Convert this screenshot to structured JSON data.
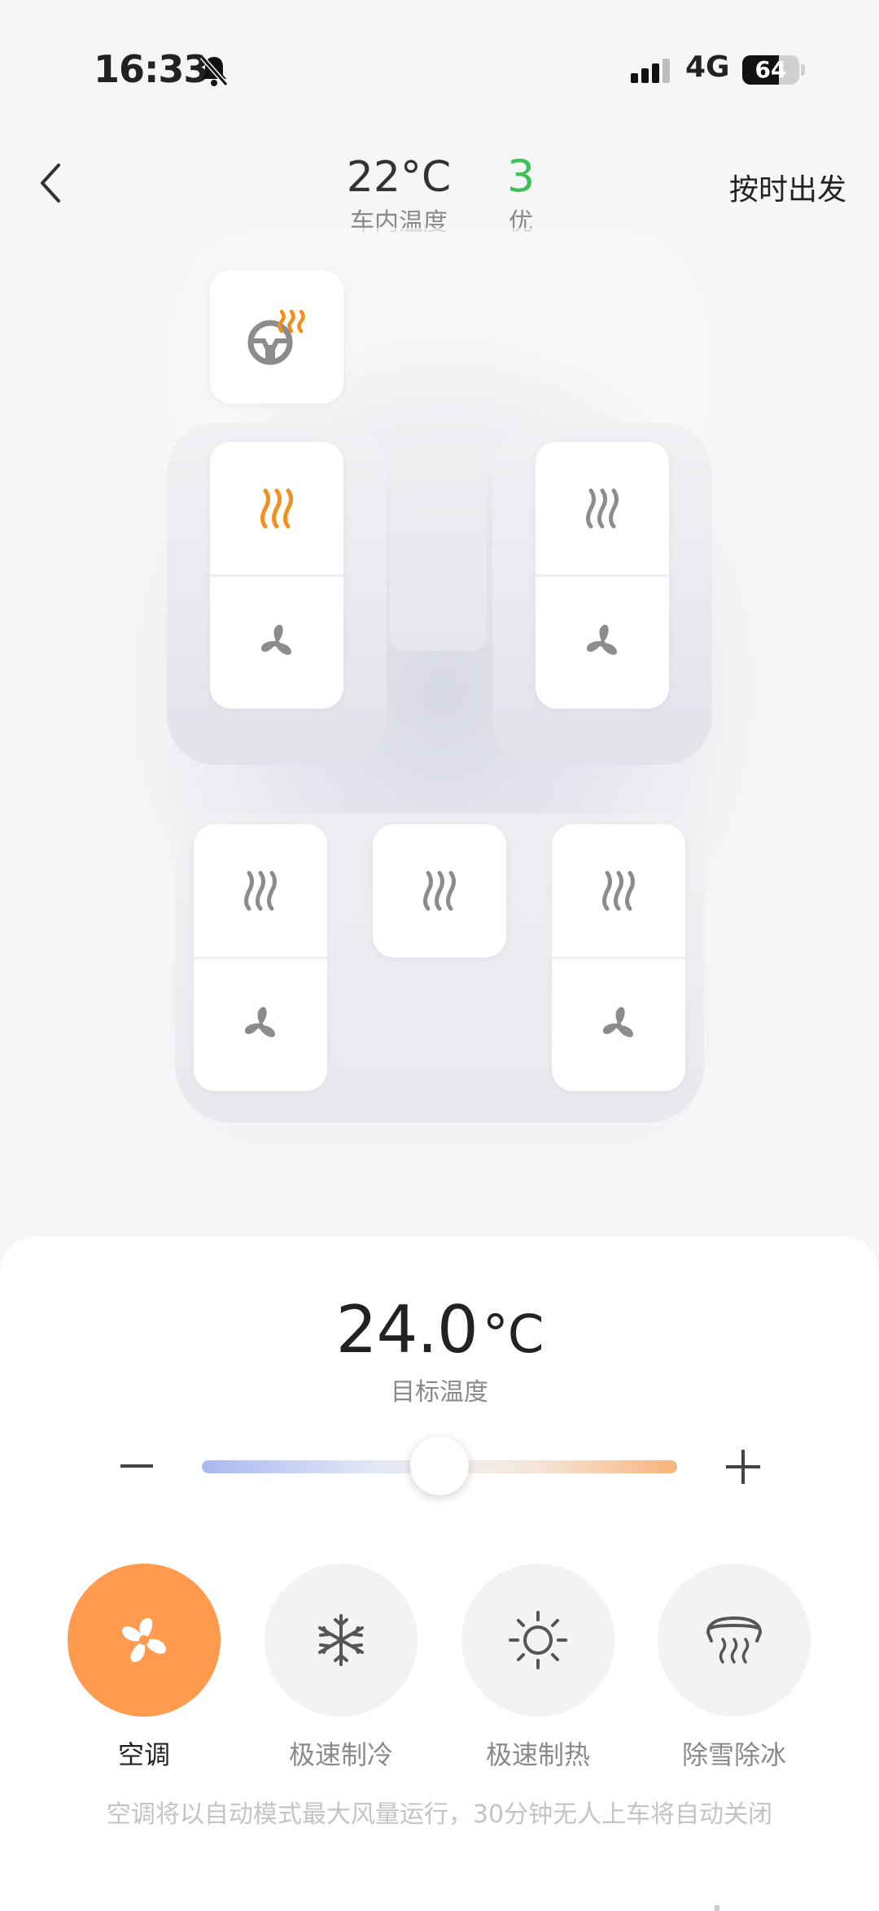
{
  "status_bar": {
    "time": "16:33",
    "network": "4G",
    "battery": "64",
    "battery_level": 0.64
  },
  "header": {
    "cabin_temp": "22°C",
    "cabin_temp_label": "车内温度",
    "air_quality_value": "3",
    "air_quality_label": "优",
    "depart_on_time_label": "按时出发"
  },
  "seats": {
    "steering_wheel_heat": {
      "icon": "steering-wheel-heat-icon",
      "active": true
    },
    "driver": {
      "heat_active": true,
      "vent_active": false
    },
    "front_passenger": {
      "heat_active": false,
      "vent_active": false
    },
    "rear_left": {
      "heat_active": false,
      "vent_active": false
    },
    "rear_center": {
      "heat_active": false
    },
    "rear_right": {
      "heat_active": false,
      "vent_active": false
    }
  },
  "climate": {
    "target_temp": "24.0",
    "target_unit": "°C",
    "target_label": "目标温度",
    "slider_fraction": 0.5,
    "minus_label": "−",
    "plus_label": "+"
  },
  "modes": [
    {
      "label": "空调",
      "icon": "ac-fan-icon",
      "active": true
    },
    {
      "label": "极速制冷",
      "icon": "snowflake-icon",
      "active": false
    },
    {
      "label": "极速制热",
      "icon": "sun-icon",
      "active": false
    },
    {
      "label": "除雪除冰",
      "icon": "defrost-icon",
      "active": false
    }
  ],
  "hint": "空调将以自动模式最大风量运行，30分钟无人上车将自动关闭",
  "colors": {
    "accent_orange": "#ff9a4e",
    "heat_on": "#f0901e",
    "icon_off": "#8c8c8c",
    "air_good": "#3fc15a"
  }
}
